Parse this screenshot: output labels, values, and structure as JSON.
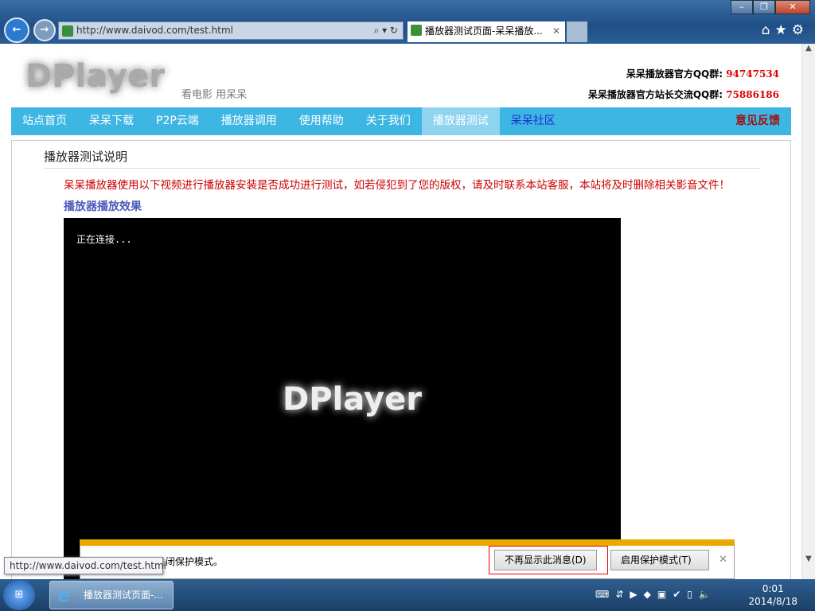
{
  "browser": {
    "url": "http://www.daivod.com/test.html",
    "tab_title": "播放器测试页面-呆呆播放...",
    "window_buttons": [
      "minimize",
      "restore",
      "close"
    ]
  },
  "header": {
    "logo": "DPlayer",
    "slogan": "看电影 用呆呆",
    "qq1_label": "呆呆播放器官方QQ群:",
    "qq1": "94747534",
    "qq2_label": "呆呆播放器官方站长交流QQ群:",
    "qq2": "75886186"
  },
  "menu": {
    "items": [
      "站点首页",
      "呆呆下载",
      "P2P云端",
      "播放器调用",
      "使用帮助",
      "关于我们",
      "播放器测试",
      "呆呆社区"
    ],
    "feedback": "意见反馈",
    "active": "播放器测试"
  },
  "content": {
    "title": "播放器测试说明",
    "notice": "呆呆播放器使用以下视频进行播放器安装是否成功进行测试，如若侵犯到了您的版权，请及时联系本站客服，本站将及时删除相关影音文件！",
    "subtitle": "播放器播放效果",
    "player_status": "正在连接...",
    "player_watermark": "DPlayer"
  },
  "notification": {
    "message": "关闭保护模式。",
    "dont_show": "不再显示此消息(D)",
    "enable": "启用保护模式(T)"
  },
  "tooltip": "http://www.daivod.com/test.html",
  "taskbar": {
    "task_label": "播放器测试页面-...",
    "time": "0:01",
    "date": "2014/8/18"
  }
}
